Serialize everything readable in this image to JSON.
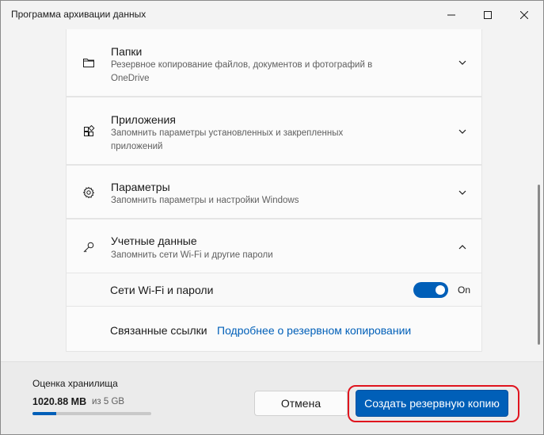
{
  "window": {
    "title": "Программа архивации данных"
  },
  "sections": [
    {
      "title": "Папки",
      "description": "Резервное копирование файлов, документов и фотографий в OneDrive",
      "icon": "folder-icon",
      "expanded": false
    },
    {
      "title": "Приложения",
      "description": "Запомнить параметры установленных и закрепленных приложений",
      "icon": "apps-icon",
      "expanded": false
    },
    {
      "title": "Параметры",
      "description": "Запомнить параметры и настройки Windows",
      "icon": "gear-icon",
      "expanded": false
    },
    {
      "title": "Учетные данные",
      "description": "Запомнить сети Wi-Fi и другие пароли",
      "icon": "key-icon",
      "expanded": true
    }
  ],
  "credentials": {
    "wifi_label": "Сети Wi-Fi и пароли",
    "wifi_state": "On",
    "related_label": "Связанные ссылки",
    "related_link": "Подробнее о резервном копировании"
  },
  "storage": {
    "title": "Оценка хранилища",
    "used": "1020.88 MB",
    "of_total": "из 5 GB",
    "used_fraction": 0.2
  },
  "buttons": {
    "cancel": "Отмена",
    "backup": "Создать резервную копию"
  },
  "colors": {
    "accent": "#005fb8",
    "highlight": "#e0141e"
  }
}
